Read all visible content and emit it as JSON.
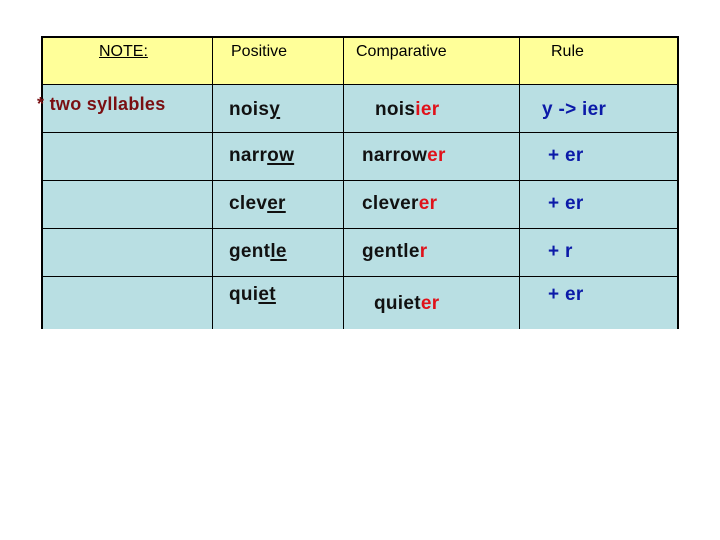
{
  "header": {
    "note": "NOTE:",
    "positive": "Positive",
    "comparative": "Comparative",
    "rule": "Rule"
  },
  "rows": [
    {
      "label": "* two syllables",
      "positive_stem": "nois",
      "positive_underlined": "y",
      "comparative_stem": "nois",
      "comparative_suffix": "ier",
      "rule": "y -> ier"
    },
    {
      "label": "",
      "positive_stem": "narr",
      "positive_underlined": "ow",
      "comparative_stem": "narrow",
      "comparative_suffix": "er",
      "rule": "+ er"
    },
    {
      "label": "",
      "positive_stem": "clev",
      "positive_underlined": "er",
      "comparative_stem": "clever",
      "comparative_suffix": "er",
      "rule": "+ er"
    },
    {
      "label": "",
      "positive_stem": "gent",
      "positive_underlined": "le",
      "comparative_stem": "gentle",
      "comparative_suffix": "r",
      "rule": "+ r"
    },
    {
      "label": "",
      "positive_stem": "qui",
      "positive_underlined": "et",
      "comparative_stem": "quiet",
      "comparative_suffix": "er",
      "rule": "+ er"
    }
  ],
  "colors": {
    "header_bg": "#ffff99",
    "body_bg": "#b9dfe3",
    "suffix_red": "#e0121a",
    "rule_blue": "#0b1aa8",
    "label_darkred": "#7a0f12"
  }
}
